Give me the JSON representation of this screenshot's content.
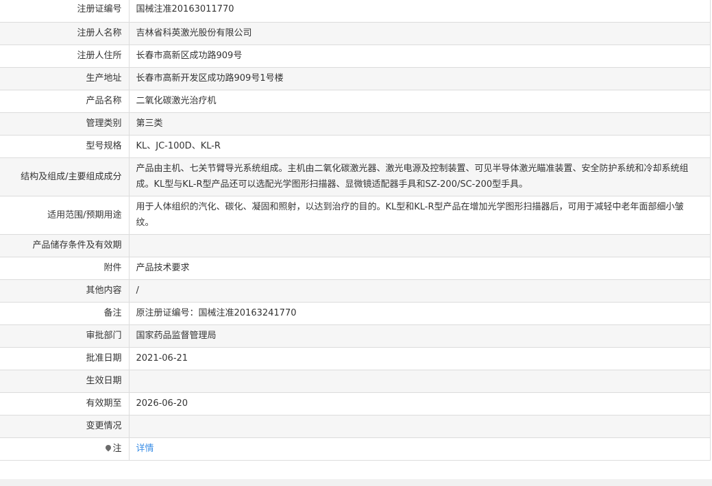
{
  "rows": [
    {
      "label": "注册证编号",
      "value": "国械注准20163011770"
    },
    {
      "label": "注册人名称",
      "value": "吉林省科英激光股份有限公司"
    },
    {
      "label": "注册人住所",
      "value": "长春市高新区成功路909号"
    },
    {
      "label": "生产地址",
      "value": "长春市高新开发区成功路909号1号楼"
    },
    {
      "label": "产品名称",
      "value": "二氧化碳激光治疗机"
    },
    {
      "label": "管理类别",
      "value": "第三类"
    },
    {
      "label": "型号规格",
      "value": "KL、JC-100D、KL-R"
    },
    {
      "label": "结构及组成/主要组成成分",
      "value": "产品由主机、七关节臂导光系统组成。主机由二氧化碳激光器、激光电源及控制装置、可见半导体激光瞄准装置、安全防护系统和冷却系统组成。KL型与KL-R型产品还可以选配光学图形扫描器、显微镜适配器手具和SZ-200/SC-200型手具。"
    },
    {
      "label": "适用范围/预期用途",
      "value": "用于人体组织的汽化、碳化、凝固和照射，以达到治疗的目的。KL型和KL-R型产品在增加光学图形扫描器后，可用于减轻中老年面部细小皱纹。"
    },
    {
      "label": "产品储存条件及有效期",
      "value": ""
    },
    {
      "label": "附件",
      "value": "产品技术要求"
    },
    {
      "label": "其他内容",
      "value": "/"
    },
    {
      "label": "备注",
      "value": "原注册证编号：国械注准20163241770"
    },
    {
      "label": "审批部门",
      "value": "国家药品监督管理局"
    },
    {
      "label": "批准日期",
      "value": "2021-06-21"
    },
    {
      "label": "生效日期",
      "value": ""
    },
    {
      "label": "有效期至",
      "value": "2026-06-20"
    },
    {
      "label": "变更情况",
      "value": ""
    }
  ],
  "note": {
    "label": "注",
    "link_text": "详情",
    "icon": "pin-icon"
  },
  "colors": {
    "link": "#3a8ee6",
    "border": "#dcdcdc",
    "row_alt": "#f6f6f6"
  }
}
